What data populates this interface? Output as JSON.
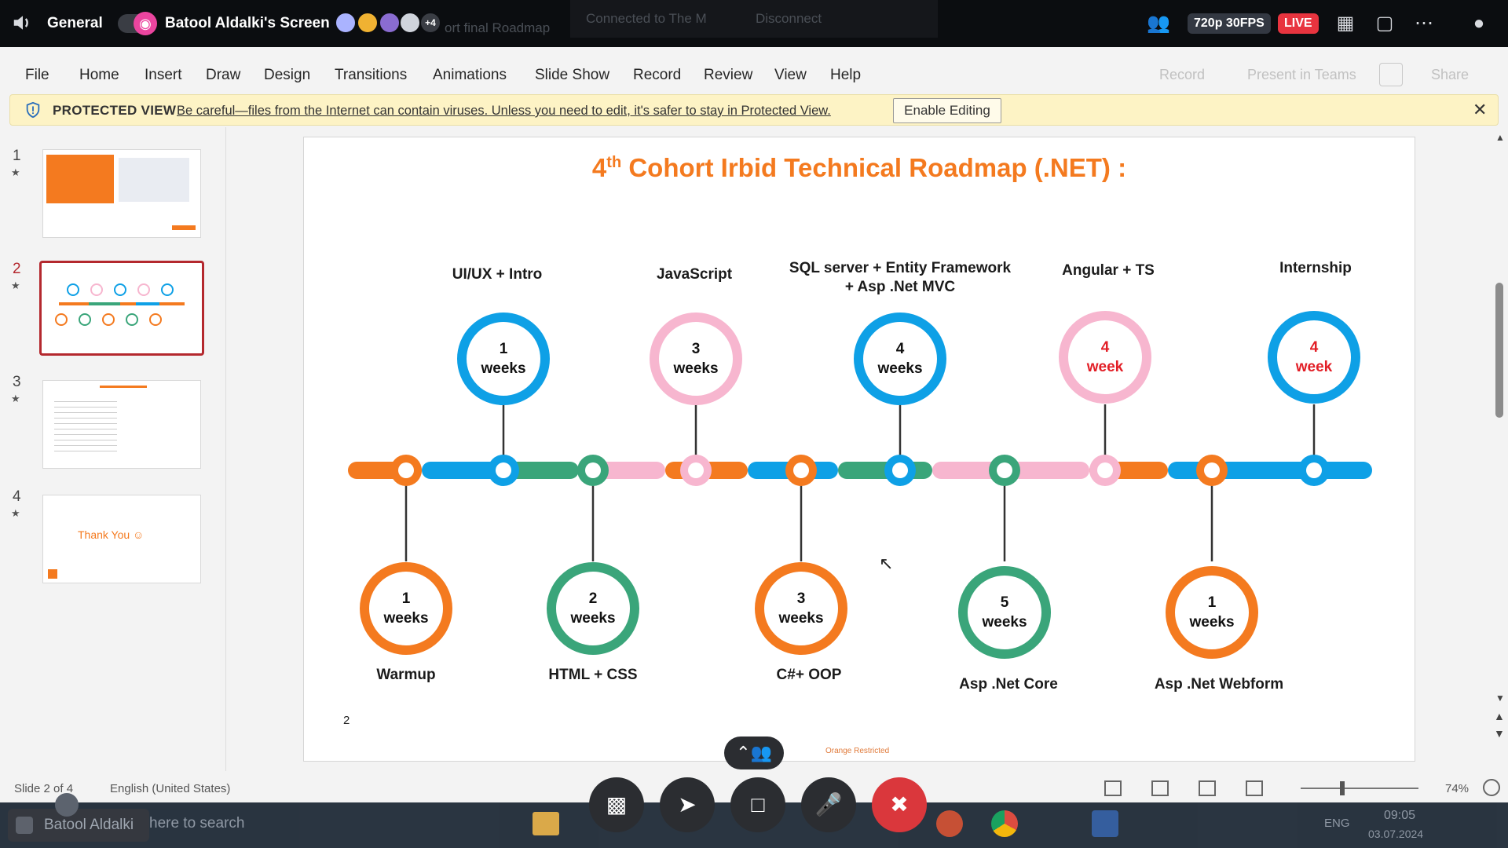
{
  "discord": {
    "channel": "General",
    "screen_title": "Batool Aldalki's Screen",
    "viewer_more": "+4",
    "ghost_title": "ort final Roadmap",
    "ghost_connected": "Connected to The M",
    "ghost_disconnect": "Disconnect",
    "quality": "720p 30FPS",
    "live": "LIVE",
    "user": "Batool Aldalki"
  },
  "ppt": {
    "menu": [
      "File",
      "Home",
      "Insert",
      "Draw",
      "Design",
      "Transitions",
      "Animations",
      "Slide Show",
      "Record",
      "Review",
      "View",
      "Help"
    ],
    "right_menu": [
      "Record",
      "Present in Teams",
      "Share"
    ],
    "protected": {
      "label": "PROTECTED VIEW",
      "message": "Be careful—files from the Internet can contain viruses. Unless you need to edit, it's safer to stay in Protected View.",
      "button": "Enable Editing"
    },
    "slides": [
      {
        "num": "1"
      },
      {
        "num": "2"
      },
      {
        "num": "3"
      },
      {
        "num": "4",
        "text": "Thank You ☺"
      }
    ],
    "status": {
      "slide_info": "Slide 2 of 4",
      "language": "English (United States)",
      "zoom": "74%"
    }
  },
  "slide": {
    "title_pre": "4",
    "title_sup": "th",
    "title_post": " Cohort Irbid Technical Roadmap (.NET) :",
    "page_number": "2",
    "footer": "Orange Restricted",
    "top_milestones": [
      {
        "label": "UI/UX + Intro",
        "num": "1",
        "unit": "weeks",
        "color": "#0ea0e6",
        "red": false
      },
      {
        "label": "JavaScript",
        "num": "3",
        "unit": "weeks",
        "color": "#f7b6cf",
        "red": false
      },
      {
        "label": "SQL server  +  Entity Framework",
        "label2": "+ Asp .Net MVC",
        "num": "4",
        "unit": "weeks",
        "color": "#0ea0e6",
        "red": false
      },
      {
        "label": "Angular + TS",
        "num": "4",
        "unit": "week",
        "color": "#f7b6cf",
        "red": true
      },
      {
        "label": "Internship",
        "num": "4",
        "unit": "week",
        "color": "#0ea0e6",
        "red": true
      }
    ],
    "bottom_milestones": [
      {
        "label": "Warmup",
        "num": "1",
        "unit": "weeks",
        "color": "#f47a1f"
      },
      {
        "label": "HTML + CSS",
        "num": "2",
        "unit": "weeks",
        "color": "#3aa57a"
      },
      {
        "label": "C#+ OOP",
        "num": "3",
        "unit": "weeks",
        "color": "#f47a1f"
      },
      {
        "label": "Asp .Net Core",
        "num": "5",
        "unit": "weeks",
        "color": "#3aa57a"
      },
      {
        "label": "Asp .Net Webform",
        "num": "1",
        "unit": "weeks",
        "color": "#f47a1f"
      }
    ]
  },
  "taskbar": {
    "search": "here to search",
    "lang": "ENG",
    "time": "09:05",
    "date": "03.07.2024"
  }
}
